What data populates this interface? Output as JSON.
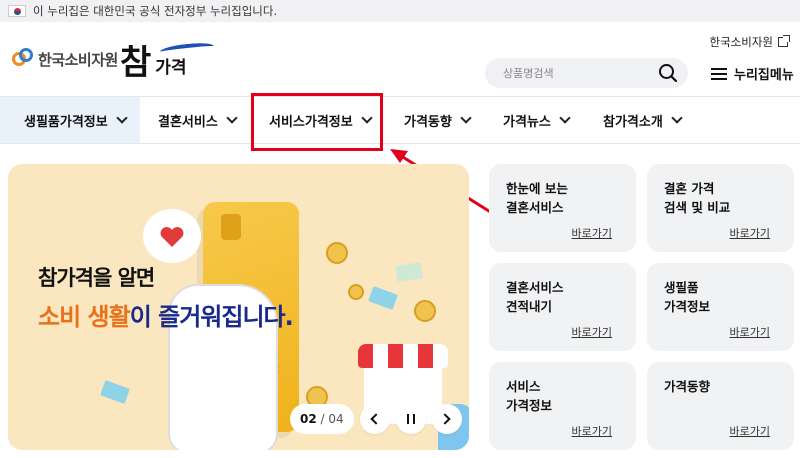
{
  "gov_banner": {
    "text": "이 누리집은 대한민국 공식 전자정부 누리집입니다."
  },
  "header": {
    "org_name": "한국소비자원",
    "brand_cham": "참",
    "brand_gagyeok": "가격",
    "kca_link": "한국소비자원",
    "search_placeholder": "상품명검색",
    "menu_label": "누리집메뉴"
  },
  "nav": {
    "items": [
      {
        "label": "생필품가격정보"
      },
      {
        "label": "결혼서비스"
      },
      {
        "label": "서비스가격정보"
      },
      {
        "label": "가격동향"
      },
      {
        "label": "가격뉴스"
      },
      {
        "label": "참가격소개"
      }
    ]
  },
  "banner": {
    "line1": "참가격을 알면",
    "line2_highlight": "소비 생활",
    "line2_rest": "이 즐거워집니다.",
    "current_page": "02",
    "separator": " / ",
    "total_pages": "04"
  },
  "quick_links": [
    {
      "title": "한눈에 보는\n결혼서비스",
      "go": "바로가기"
    },
    {
      "title": "결혼 가격\n검색 및 비교",
      "go": "바로가기"
    },
    {
      "title": "결혼서비스\n견적내기",
      "go": "바로가기"
    },
    {
      "title": "생필품\n가격정보",
      "go": "바로가기"
    },
    {
      "title": "서비스\n가격정보",
      "go": "바로가기"
    },
    {
      "title": "가격동향",
      "go": "바로가기"
    }
  ],
  "colors": {
    "accent_blue": "#1a2a8a",
    "accent_orange": "#e8711c",
    "highlight_red": "#e3001b",
    "banner_bg": "#fbe7bf",
    "card_bg": "#f1f2f4",
    "nav_active_bg": "#e9f1fb"
  }
}
